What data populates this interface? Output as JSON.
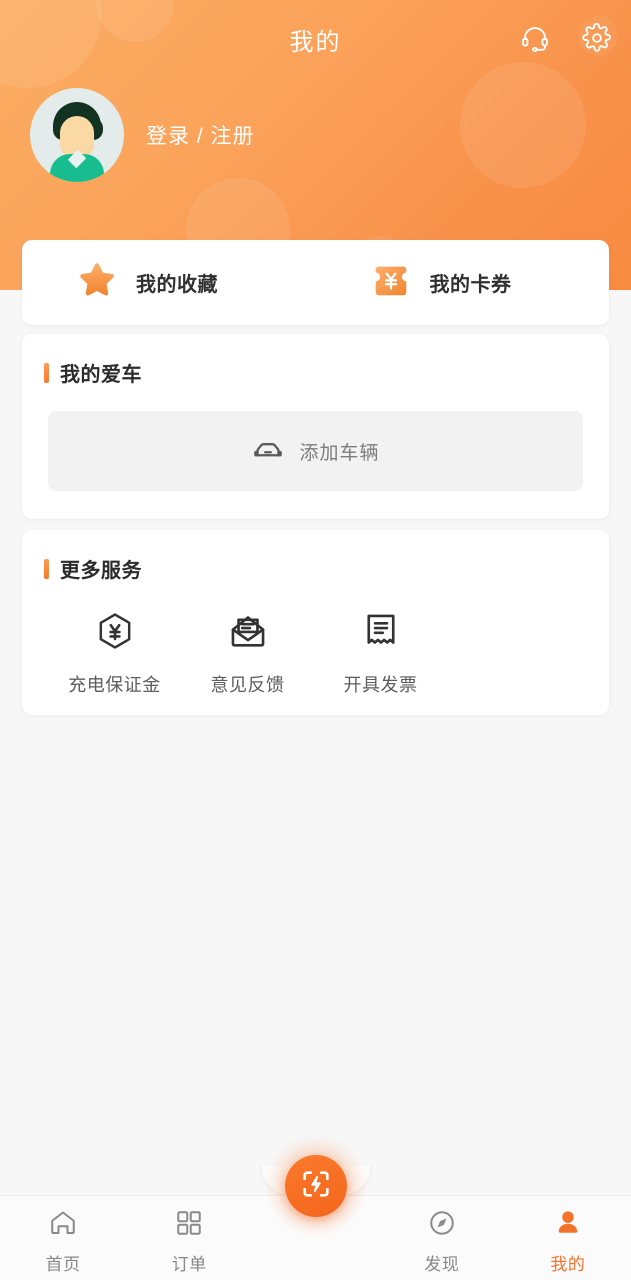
{
  "header": {
    "title": "我的",
    "support_icon": "headset-icon",
    "settings_icon": "gear-icon",
    "avatar_icon": "user-avatar",
    "login_label": "登录 / 注册",
    "bg_color_start": "#fbad63",
    "bg_color_end": "#f78b40"
  },
  "quick_actions": [
    {
      "label": "我的收藏",
      "icon": "star-icon"
    },
    {
      "label": "我的卡券",
      "icon": "coupon-icon"
    }
  ],
  "my_car": {
    "section_title": "我的爱车",
    "add_label": "添加车辆",
    "add_icon": "car-icon"
  },
  "more_services": {
    "section_title": "更多服务",
    "items": [
      {
        "label": "充电保证金",
        "icon": "hexagon-yuan-icon"
      },
      {
        "label": "意见反馈",
        "icon": "envelope-icon"
      },
      {
        "label": "开具发票",
        "icon": "receipt-icon"
      }
    ]
  },
  "tabbar": {
    "accent_color": "#f4732a",
    "inactive_color": "#888888",
    "scan_icon": "scan-charge-icon",
    "tabs": [
      {
        "label": "首页",
        "icon": "home-icon",
        "active": false
      },
      {
        "label": "订单",
        "icon": "grid-icon",
        "active": false
      },
      {
        "label": "发现",
        "icon": "compass-icon",
        "active": false
      },
      {
        "label": "我的",
        "icon": "person-icon",
        "active": true
      }
    ]
  }
}
